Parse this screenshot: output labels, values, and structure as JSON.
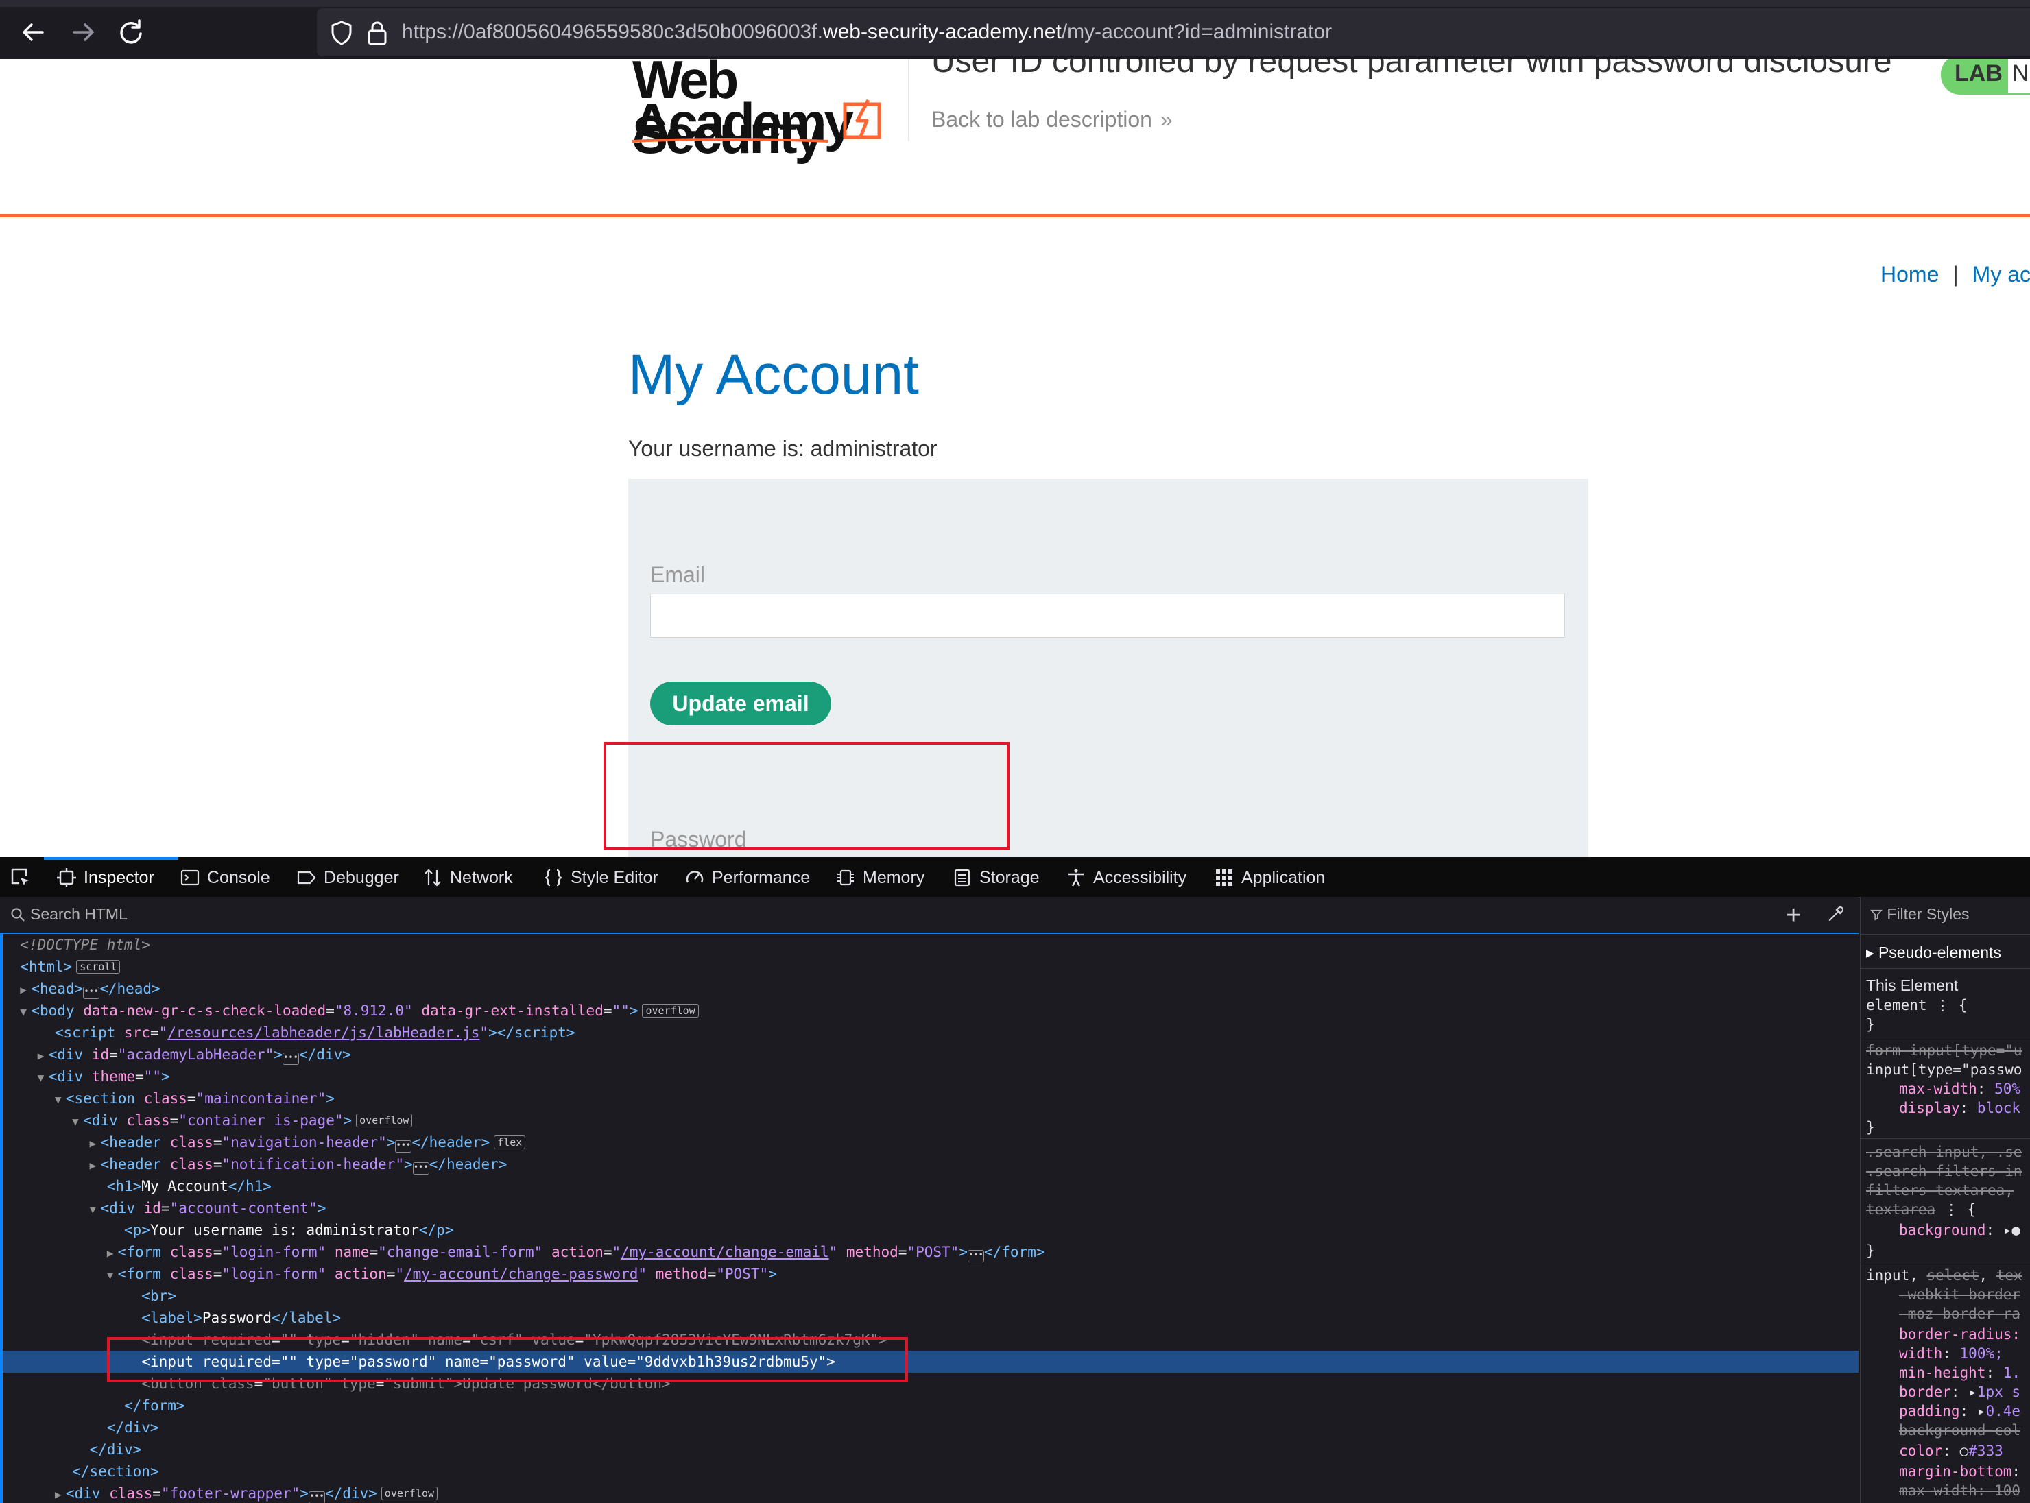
{
  "browser": {
    "url_prefix": "https://0af800560496559580c3d50b0096003f.",
    "url_domain": "web-security-academy.net",
    "url_path": "/my-account?id=administrator"
  },
  "lab_header": {
    "logo_line1": "Web Security",
    "logo_line2": "Academy",
    "title": "User ID controlled by request parameter with password disclosure",
    "back_link": "Back to lab description",
    "back_chevron": "»",
    "badge": "LAB",
    "badge_status_initial": "N"
  },
  "nav": {
    "home": "Home",
    "separator": "|",
    "my_account": "My ac"
  },
  "account": {
    "heading": "My Account",
    "username_text": "Your username is: administrator",
    "email_label": "Email",
    "email_value": "",
    "update_email_button": "Update email",
    "password_label": "Password",
    "password_masked": "••••••••••••••••••••"
  },
  "devtools": {
    "tabs": [
      {
        "label": "Inspector",
        "icon": "inspector-icon",
        "active": true
      },
      {
        "label": "Console",
        "icon": "console-icon"
      },
      {
        "label": "Debugger",
        "icon": "debugger-icon"
      },
      {
        "label": "Network",
        "icon": "network-icon"
      },
      {
        "label": "Style Editor",
        "icon": "style-editor-icon"
      },
      {
        "label": "Performance",
        "icon": "performance-icon"
      },
      {
        "label": "Memory",
        "icon": "memory-icon"
      },
      {
        "label": "Storage",
        "icon": "storage-icon"
      },
      {
        "label": "Accessibility",
        "icon": "accessibility-icon"
      },
      {
        "label": "Application",
        "icon": "application-icon"
      }
    ],
    "search_placeholder": "Search HTML",
    "filter_styles": "Filter Styles",
    "pseudo_elements": "Pseudo-elements",
    "this_element": "This Element",
    "markup": {
      "doctype": "<!DOCTYPE html>",
      "html_tag": "html",
      "scroll_badge": "scroll",
      "head_tag": "head",
      "body_tag": "body",
      "body_attr1_name": "data-new-gr-c-s-check-loaded",
      "body_attr1_value": "8.912.0",
      "body_attr2_name": "data-gr-ext-installed",
      "body_attr2_value": "",
      "overflow_badge": "overflow",
      "flex_badge": "flex",
      "script_src": "/resources/labheader/js/labHeader.js",
      "academy_header_id": "academyLabHeader",
      "theme_attr": "theme",
      "section_class": "maincontainer",
      "container_class": "container is-page",
      "nav_header_class": "navigation-header",
      "notif_header_class": "notification-header",
      "h1_text": "My Account",
      "account_content_id": "account-content",
      "p_text": "Your username is: administrator",
      "email_form_class": "login-form",
      "email_form_name": "change-email-form",
      "email_form_action": "/my-account/change-email",
      "form_method": "POST",
      "pw_form_action": "/my-account/change-password",
      "label_text": "Password",
      "csrf_name": "csrf",
      "csrf_value": "YpkwQqpf2853VicYEw9NLxRbtm6zk7gK",
      "pw_input_type": "password",
      "pw_input_name": "password",
      "pw_input_value": "9ddvxb1h39us2rdbmu5y",
      "button_class": "button",
      "button_type": "submit",
      "button_text": "Update password",
      "footer_class": "footer-wrapper"
    }
  },
  "colors": {
    "accent_orange": "#ff6633",
    "link_blue": "#0071bc",
    "button_green": "#1a9e7a",
    "highlight_red": "#e0162b",
    "devtools_selection": "#204e8a"
  }
}
